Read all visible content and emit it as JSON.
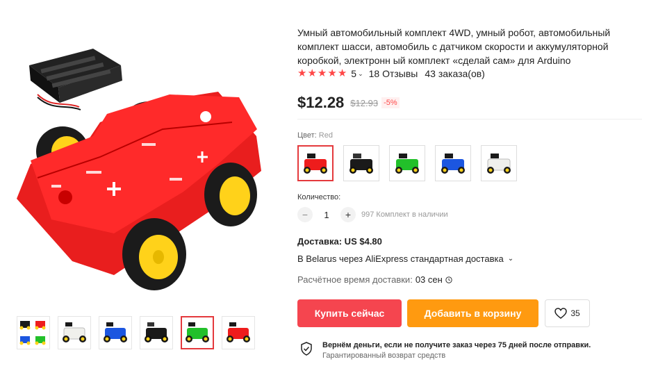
{
  "product": {
    "title": "Умный автомобильный комплект 4WD, умный робот, автомобильный комплект шасси, автомобиль с датчиком скорости и аккумуляторной коробкой, электронн ый комплект «сделай сам» для Arduino",
    "rating_value": "5",
    "reviews": "18 Отзывы",
    "orders": "43 заказа(ов)"
  },
  "price": {
    "current": "$12.28",
    "old": "$12.93",
    "discount": "-5%"
  },
  "color": {
    "label": "Цвет:",
    "selected": "Red",
    "options": [
      {
        "name": "red",
        "chassis": "#ee1c1c"
      },
      {
        "name": "black",
        "chassis": "#1a1a1a"
      },
      {
        "name": "green",
        "chassis": "#22c02a"
      },
      {
        "name": "blue",
        "chassis": "#1c56e0"
      },
      {
        "name": "white",
        "chassis": "#f0f0ec"
      }
    ]
  },
  "gallery": {
    "thumbs": [
      {
        "name": "multi"
      },
      {
        "name": "white",
        "chassis": "#f0f0ec"
      },
      {
        "name": "blue",
        "chassis": "#1c56e0"
      },
      {
        "name": "black",
        "chassis": "#1a1a1a"
      },
      {
        "name": "green",
        "chassis": "#22c02a"
      },
      {
        "name": "red",
        "chassis": "#ee1c1c"
      }
    ]
  },
  "quantity": {
    "label": "Количество:",
    "value": "1",
    "minus": "−",
    "plus": "+",
    "stock": "997 Комплект в наличии"
  },
  "delivery": {
    "title": "Доставка: US $4.80",
    "method": "В Belarus через AliExpress стандартная доставка",
    "eta_label": "Расчётное время доставки:",
    "eta_value": "03 сен"
  },
  "actions": {
    "buy": "Купить сейчас",
    "cart": "Добавить в корзину",
    "wish_count": "35"
  },
  "guarantee": {
    "title": "Вернём деньги, если не получите заказ через 75 дней после отправки.",
    "subtitle": "Гарантированный возврат средств"
  },
  "colors": {
    "accent": "#f5454f",
    "cart": "#ff9a10",
    "star": "#ff4747",
    "wheel": "#ffd21a"
  }
}
